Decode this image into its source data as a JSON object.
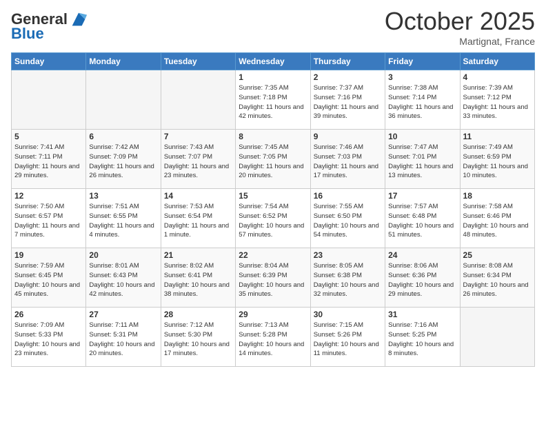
{
  "header": {
    "logo_general": "General",
    "logo_blue": "Blue",
    "month": "October 2025",
    "location": "Martignat, France"
  },
  "weekdays": [
    "Sunday",
    "Monday",
    "Tuesday",
    "Wednesday",
    "Thursday",
    "Friday",
    "Saturday"
  ],
  "weeks": [
    [
      {
        "day": "",
        "info": ""
      },
      {
        "day": "",
        "info": ""
      },
      {
        "day": "",
        "info": ""
      },
      {
        "day": "1",
        "info": "Sunrise: 7:35 AM\nSunset: 7:18 PM\nDaylight: 11 hours and 42 minutes."
      },
      {
        "day": "2",
        "info": "Sunrise: 7:37 AM\nSunset: 7:16 PM\nDaylight: 11 hours and 39 minutes."
      },
      {
        "day": "3",
        "info": "Sunrise: 7:38 AM\nSunset: 7:14 PM\nDaylight: 11 hours and 36 minutes."
      },
      {
        "day": "4",
        "info": "Sunrise: 7:39 AM\nSunset: 7:12 PM\nDaylight: 11 hours and 33 minutes."
      }
    ],
    [
      {
        "day": "5",
        "info": "Sunrise: 7:41 AM\nSunset: 7:11 PM\nDaylight: 11 hours and 29 minutes."
      },
      {
        "day": "6",
        "info": "Sunrise: 7:42 AM\nSunset: 7:09 PM\nDaylight: 11 hours and 26 minutes."
      },
      {
        "day": "7",
        "info": "Sunrise: 7:43 AM\nSunset: 7:07 PM\nDaylight: 11 hours and 23 minutes."
      },
      {
        "day": "8",
        "info": "Sunrise: 7:45 AM\nSunset: 7:05 PM\nDaylight: 11 hours and 20 minutes."
      },
      {
        "day": "9",
        "info": "Sunrise: 7:46 AM\nSunset: 7:03 PM\nDaylight: 11 hours and 17 minutes."
      },
      {
        "day": "10",
        "info": "Sunrise: 7:47 AM\nSunset: 7:01 PM\nDaylight: 11 hours and 13 minutes."
      },
      {
        "day": "11",
        "info": "Sunrise: 7:49 AM\nSunset: 6:59 PM\nDaylight: 11 hours and 10 minutes."
      }
    ],
    [
      {
        "day": "12",
        "info": "Sunrise: 7:50 AM\nSunset: 6:57 PM\nDaylight: 11 hours and 7 minutes."
      },
      {
        "day": "13",
        "info": "Sunrise: 7:51 AM\nSunset: 6:55 PM\nDaylight: 11 hours and 4 minutes."
      },
      {
        "day": "14",
        "info": "Sunrise: 7:53 AM\nSunset: 6:54 PM\nDaylight: 11 hours and 1 minute."
      },
      {
        "day": "15",
        "info": "Sunrise: 7:54 AM\nSunset: 6:52 PM\nDaylight: 10 hours and 57 minutes."
      },
      {
        "day": "16",
        "info": "Sunrise: 7:55 AM\nSunset: 6:50 PM\nDaylight: 10 hours and 54 minutes."
      },
      {
        "day": "17",
        "info": "Sunrise: 7:57 AM\nSunset: 6:48 PM\nDaylight: 10 hours and 51 minutes."
      },
      {
        "day": "18",
        "info": "Sunrise: 7:58 AM\nSunset: 6:46 PM\nDaylight: 10 hours and 48 minutes."
      }
    ],
    [
      {
        "day": "19",
        "info": "Sunrise: 7:59 AM\nSunset: 6:45 PM\nDaylight: 10 hours and 45 minutes."
      },
      {
        "day": "20",
        "info": "Sunrise: 8:01 AM\nSunset: 6:43 PM\nDaylight: 10 hours and 42 minutes."
      },
      {
        "day": "21",
        "info": "Sunrise: 8:02 AM\nSunset: 6:41 PM\nDaylight: 10 hours and 38 minutes."
      },
      {
        "day": "22",
        "info": "Sunrise: 8:04 AM\nSunset: 6:39 PM\nDaylight: 10 hours and 35 minutes."
      },
      {
        "day": "23",
        "info": "Sunrise: 8:05 AM\nSunset: 6:38 PM\nDaylight: 10 hours and 32 minutes."
      },
      {
        "day": "24",
        "info": "Sunrise: 8:06 AM\nSunset: 6:36 PM\nDaylight: 10 hours and 29 minutes."
      },
      {
        "day": "25",
        "info": "Sunrise: 8:08 AM\nSunset: 6:34 PM\nDaylight: 10 hours and 26 minutes."
      }
    ],
    [
      {
        "day": "26",
        "info": "Sunrise: 7:09 AM\nSunset: 5:33 PM\nDaylight: 10 hours and 23 minutes."
      },
      {
        "day": "27",
        "info": "Sunrise: 7:11 AM\nSunset: 5:31 PM\nDaylight: 10 hours and 20 minutes."
      },
      {
        "day": "28",
        "info": "Sunrise: 7:12 AM\nSunset: 5:30 PM\nDaylight: 10 hours and 17 minutes."
      },
      {
        "day": "29",
        "info": "Sunrise: 7:13 AM\nSunset: 5:28 PM\nDaylight: 10 hours and 14 minutes."
      },
      {
        "day": "30",
        "info": "Sunrise: 7:15 AM\nSunset: 5:26 PM\nDaylight: 10 hours and 11 minutes."
      },
      {
        "day": "31",
        "info": "Sunrise: 7:16 AM\nSunset: 5:25 PM\nDaylight: 10 hours and 8 minutes."
      },
      {
        "day": "",
        "info": ""
      }
    ]
  ]
}
